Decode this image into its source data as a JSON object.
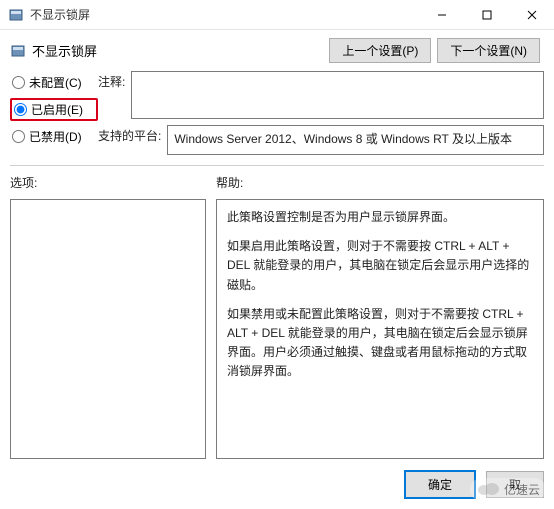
{
  "window": {
    "title": "不显示锁屏",
    "icon": "gpo-setting-icon"
  },
  "header": {
    "label": "不显示锁屏",
    "nav": {
      "prev": "上一个设置(P)",
      "next": "下一个设置(N)"
    }
  },
  "radios": {
    "not_configured": "未配置(C)",
    "enabled": "已启用(E)",
    "disabled": "已禁用(D)",
    "selected": "enabled"
  },
  "comment": {
    "label": "注释:",
    "value": ""
  },
  "platform": {
    "label": "支持的平台:",
    "value": "Windows Server 2012、Windows 8 或 Windows RT 及以上版本"
  },
  "options": {
    "label": "选项:"
  },
  "help": {
    "label": "帮助:",
    "paragraphs": [
      "此策略设置控制是否为用户显示锁屏界面。",
      "如果启用此策略设置，则对于不需要按 CTRL + ALT + DEL 就能登录的用户，其电脑在锁定后会显示用户选择的磁贴。",
      "如果禁用或未配置此策略设置，则对于不需要按 CTRL + ALT + DEL 就能登录的用户，其电脑在锁定后会显示锁屏界面。用户必须通过触摸、键盘或者用鼠标拖动的方式取消锁屏界面。"
    ]
  },
  "footer": {
    "ok": "确定",
    "cancel": "取"
  },
  "watermark": "亿速云"
}
